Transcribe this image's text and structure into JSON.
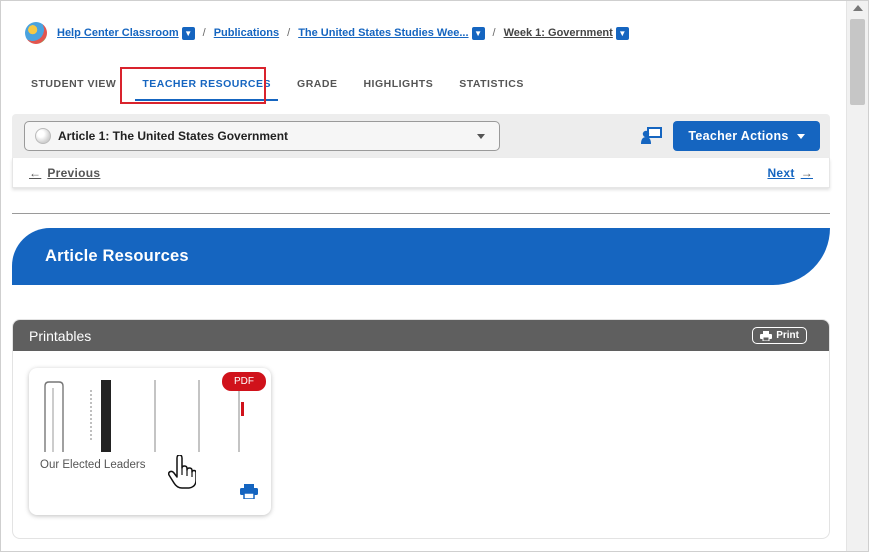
{
  "breadcrumb": {
    "items": [
      {
        "label": "Help Center Classroom"
      },
      {
        "label": "Publications"
      },
      {
        "label": "The United States Studies Wee..."
      },
      {
        "label": "Week 1: Government"
      }
    ],
    "separator": "/"
  },
  "tabs": [
    {
      "label": "STUDENT VIEW"
    },
    {
      "label": "TEACHER RESOURCES",
      "active": true
    },
    {
      "label": "GRADE"
    },
    {
      "label": "HIGHLIGHTS"
    },
    {
      "label": "STATISTICS"
    }
  ],
  "article_selector": {
    "value": "Article 1: The United States Government"
  },
  "teacher_actions": {
    "label": "Teacher Actions"
  },
  "nav": {
    "previous": "Previous",
    "next": "Next"
  },
  "banner": {
    "title": "Article Resources"
  },
  "printables": {
    "title": "Printables",
    "print_label": "Print",
    "cards": [
      {
        "title": "Our Elected Leaders",
        "badge": "PDF"
      }
    ]
  },
  "colors": {
    "accent": "#1565c0",
    "highlight": "#d9232d",
    "badge": "#d0121b",
    "panel_header": "#5f5f5f"
  }
}
